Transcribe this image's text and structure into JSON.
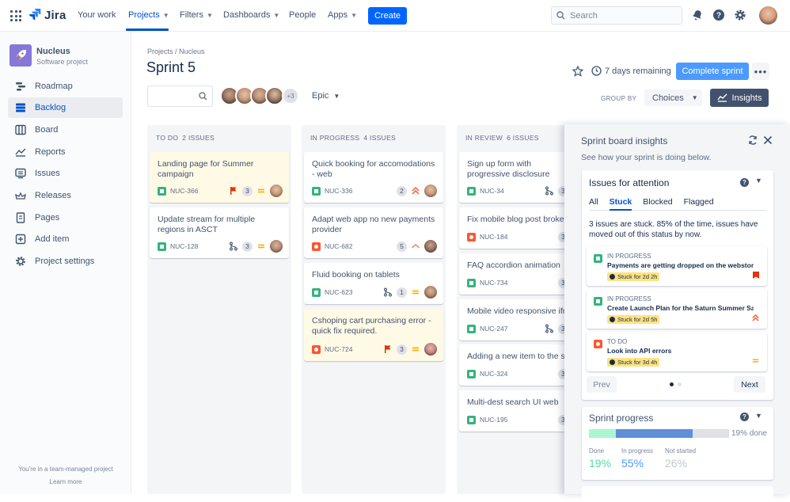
{
  "topnav": {
    "logo": "Jira",
    "items": [
      {
        "label": "Your work",
        "dropdown": false
      },
      {
        "label": "Projects",
        "dropdown": true,
        "active": true
      },
      {
        "label": "Filters",
        "dropdown": true
      },
      {
        "label": "Dashboards",
        "dropdown": true
      },
      {
        "label": "People",
        "dropdown": false
      },
      {
        "label": "Apps",
        "dropdown": true
      }
    ],
    "create_label": "Create",
    "search_placeholder": "Search",
    "icons": [
      "notifications-icon",
      "help-icon",
      "settings-icon",
      "profile-avatar"
    ]
  },
  "sidebar": {
    "project_name": "Nucleus",
    "project_type": "Software project",
    "items": [
      {
        "label": "Roadmap",
        "icon": "roadmap-icon"
      },
      {
        "label": "Backlog",
        "icon": "backlog-icon",
        "active": true
      },
      {
        "label": "Board",
        "icon": "board-icon"
      },
      {
        "label": "Reports",
        "icon": "reports-icon"
      },
      {
        "label": "Issues",
        "icon": "issues-icon"
      },
      {
        "label": "Releases",
        "icon": "releases-icon"
      },
      {
        "label": "Pages",
        "icon": "pages-icon"
      },
      {
        "label": "Add item",
        "icon": "add-item-icon"
      },
      {
        "label": "Project settings",
        "icon": "settings-icon"
      }
    ],
    "footer_text": "You're in a team-managed project",
    "footer_link": "Learn more"
  },
  "header": {
    "breadcrumb": "Projects / Nucleus",
    "title": "Sprint 5",
    "days_remaining": "7 days remaining",
    "complete_label": "Complete sprint",
    "more_label": "•••"
  },
  "toolbar": {
    "avatar_more": "+3",
    "epic_label": "Epic",
    "groupby_label": "GROUP BY",
    "choices_label": "Choices",
    "insights_label": "Insights"
  },
  "columns": [
    {
      "title": "TO DO",
      "count": "2 ISSUES",
      "cards": [
        {
          "title": "Landing page for Summer campaign",
          "key": "NUC-366",
          "type": "story",
          "extra": "flag",
          "points": "3",
          "priority": "medium",
          "highlight": true
        },
        {
          "title": "Update stream for multiple regions in ASCT",
          "key": "NUC-128",
          "type": "story",
          "extra": "branch",
          "points": "3",
          "priority": "medium",
          "highlight": false
        }
      ]
    },
    {
      "title": "IN PROGRESS",
      "count": "4 ISSUES",
      "cards": [
        {
          "title": "Quick booking for accomodations - web",
          "key": "NUC-336",
          "type": "story",
          "extra": "",
          "points": "2",
          "priority": "highest",
          "highlight": false
        },
        {
          "title": "Adapt web app no new payments provider",
          "key": "NUC-682",
          "type": "bug",
          "extra": "",
          "points": "5",
          "priority": "low",
          "highlight": false
        },
        {
          "title": "Fluid booking on tablets",
          "key": "NUC-623",
          "type": "story",
          "extra": "branch",
          "points": "1",
          "priority": "medium",
          "highlight": false
        },
        {
          "title": "Cshoping cart purchasing error - quick fix required.",
          "key": "NUC-724",
          "type": "bug",
          "extra": "flag",
          "points": "3",
          "priority": "medium",
          "highlight": true
        }
      ]
    },
    {
      "title": "IN REVIEW",
      "count": "6 ISSUES",
      "cards": [
        {
          "title": "Sign up form with progressive disclosure",
          "key": "NUC-34",
          "type": "story",
          "extra": "branch",
          "points": "3",
          "priority": "",
          "highlight": false
        },
        {
          "title": "Fix mobile blog post broken",
          "key": "NUC-184",
          "type": "bug",
          "extra": "",
          "points": "3",
          "priority": "",
          "highlight": false
        },
        {
          "title": "FAQ accordion animation",
          "key": "NUC-734",
          "type": "story",
          "extra": "",
          "points": "3",
          "priority": "",
          "highlight": false
        },
        {
          "title": "Mobile video responsive iframe",
          "key": "NUC-247",
          "type": "story",
          "extra": "branch",
          "points": "3",
          "priority": "",
          "highlight": false
        },
        {
          "title": "Adding a new item to the shop",
          "key": "NUC-324",
          "type": "story",
          "extra": "",
          "points": "3",
          "priority": "",
          "highlight": false
        },
        {
          "title": "Multi-dest search UI web",
          "key": "NUC-195",
          "type": "story",
          "extra": "",
          "points": "3",
          "priority": "",
          "highlight": false
        }
      ]
    }
  ],
  "insights": {
    "title": "Sprint board insights",
    "subtitle": "See how your sprint is doing below.",
    "attention": {
      "title": "Issues for attention",
      "tabs": [
        "All",
        "Stuck",
        "Blocked",
        "Flagged"
      ],
      "selected_tab": "Stuck",
      "summary": "3 issues are stuck. 85% of the time, issues have moved out of this status by now.",
      "issues": [
        {
          "status": "IN PROGRESS",
          "title": "Payments are getting dropped on the webstore",
          "stuck": "Stuck for 2d 2h",
          "type": "story",
          "priority": "highest-red"
        },
        {
          "status": "IN PROGRESS",
          "title": "Create Launch Plan for the Saturn Summer Sale",
          "stuck": "Stuck for 2d 5h",
          "type": "story",
          "priority": "high"
        },
        {
          "status": "TO DO",
          "title": "Look into API errors",
          "stuck": "Stuck for 3d 4h",
          "type": "bug",
          "priority": "medium"
        }
      ],
      "prev_label": "Prev",
      "next_label": "Next"
    },
    "progress": {
      "title": "Sprint progress",
      "pct_label": "19% done",
      "done": 0.19,
      "in_progress": 0.55,
      "not_started": 0.26,
      "stats": [
        {
          "label": "Done",
          "value": "19%",
          "color": "#36b37e"
        },
        {
          "label": "In progress",
          "value": "55%",
          "color": "#0065ff"
        },
        {
          "label": "Not started",
          "value": "26%",
          "color": "#b3bac5"
        }
      ]
    }
  },
  "colors": {
    "accent": "#0052cc",
    "create": "#0065ff",
    "story": "#36b37e",
    "bug": "#ff5630",
    "highlight": "#fffae6"
  }
}
